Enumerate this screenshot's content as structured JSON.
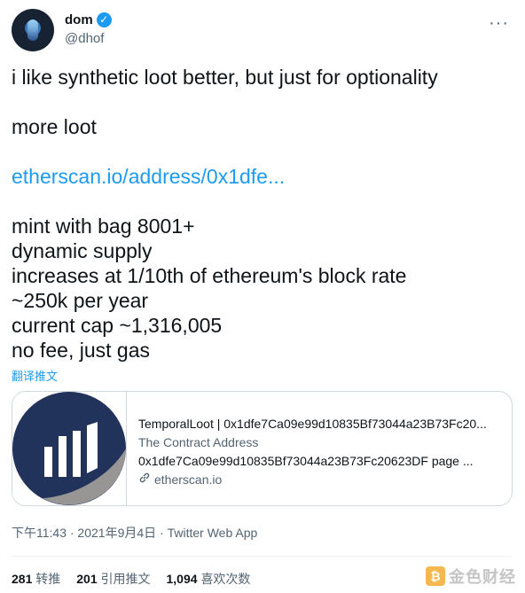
{
  "author": {
    "name": "dom",
    "handle": "@dhof"
  },
  "tweet": {
    "line1": "i like synthetic loot better, but just for optionality",
    "line2": "more loot",
    "link": "etherscan.io/address/0x1dfe...",
    "lines": [
      "mint with bag 8001+",
      "dynamic supply",
      "increases at 1/10th of ethereum's block rate",
      "~250k per year",
      "current cap ~1,316,005",
      "no fee, just gas"
    ]
  },
  "translate_label": "翻译推文",
  "card": {
    "title": "TemporalLoot | 0x1dfe7Ca09e99d10835Bf73044a23B73Fc20...",
    "description": "The Contract Address",
    "description2": "0x1dfe7Ca09e99d10835Bf73044a23B73Fc20623DF page ...",
    "domain": "etherscan.io"
  },
  "meta": {
    "timestamp": "下午11:43 · 2021年9月4日 · Twitter Web App"
  },
  "stats": {
    "retweets": "281",
    "retweets_label": "转推",
    "quotes": "201",
    "quotes_label": "引用推文",
    "likes": "1,094",
    "likes_label": "喜欢次数"
  },
  "watermark": {
    "text": "金色财经"
  },
  "colors": {
    "accent": "#1d9bf0",
    "etherscan_navy": "#21325b",
    "etherscan_gray": "#979695"
  }
}
